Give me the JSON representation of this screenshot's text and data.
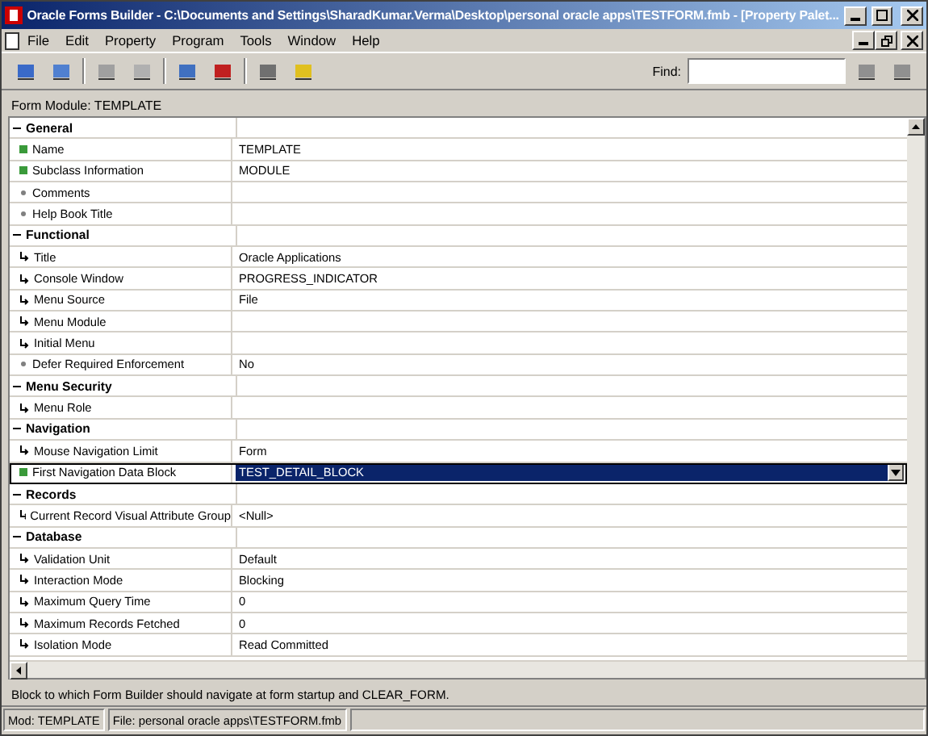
{
  "window": {
    "title": "Oracle Forms Builder - C:\\Documents and Settings\\SharadKumar.Verma\\Desktop\\personal oracle apps\\TESTFORM.fmb - [Property Palet..."
  },
  "menu": [
    {
      "label": "File"
    },
    {
      "label": "Edit"
    },
    {
      "label": "Property"
    },
    {
      "label": "Program"
    },
    {
      "label": "Tools"
    },
    {
      "label": "Window"
    },
    {
      "label": "Help"
    }
  ],
  "find": {
    "label": "Find:"
  },
  "context": "Form Module: TEMPLATE",
  "groups": [
    {
      "label": "General",
      "expanded": true,
      "properties": [
        {
          "name": "Name",
          "kind": "set",
          "value": "TEMPLATE",
          "selected": false
        },
        {
          "name": "Subclass Information",
          "kind": "set",
          "value": "MODULE",
          "selected": false
        },
        {
          "name": "Comments",
          "kind": "default",
          "selected": false
        },
        {
          "name": "Help Book Title",
          "kind": "default",
          "selected": false
        }
      ]
    },
    {
      "label": "Functional",
      "expanded": true,
      "properties": [
        {
          "name": "Title",
          "kind": "inherited",
          "value": "Oracle Applications",
          "selected": false
        },
        {
          "name": "Console Window",
          "kind": "inherited",
          "value": "PROGRESS_INDICATOR",
          "selected": false
        },
        {
          "name": "Menu Source",
          "kind": "inherited",
          "value": "File",
          "selected": false
        },
        {
          "name": "Menu Module",
          "kind": "inherited",
          "selected": false
        },
        {
          "name": "Initial Menu",
          "kind": "inherited",
          "selected": false
        },
        {
          "name": "Defer Required Enforcement",
          "kind": "default",
          "value": "No",
          "selected": false
        }
      ]
    },
    {
      "label": "Menu Security",
      "expanded": true,
      "properties": [
        {
          "name": "Menu Role",
          "kind": "inherited",
          "selected": false
        }
      ]
    },
    {
      "label": "Navigation",
      "expanded": true,
      "properties": [
        {
          "name": "Mouse Navigation Limit",
          "kind": "inherited",
          "value": "Form",
          "selected": false
        },
        {
          "name": "First Navigation Data Block",
          "kind": "set",
          "value": "TEST_DETAIL_BLOCK",
          "selected": true
        }
      ]
    },
    {
      "label": "Records",
      "expanded": true,
      "properties": [
        {
          "name": "Current Record Visual Attribute Group",
          "kind": "inherited",
          "value": "<Null>",
          "selected": false
        }
      ]
    },
    {
      "label": "Database",
      "expanded": true,
      "properties": [
        {
          "name": "Validation Unit",
          "kind": "inherited",
          "value": "Default",
          "selected": false
        },
        {
          "name": "Interaction Mode",
          "kind": "inherited",
          "value": "Blocking",
          "selected": false
        },
        {
          "name": "Maximum Query Time",
          "kind": "inherited",
          "value": "0",
          "selected": false
        },
        {
          "name": "Maximum Records Fetched",
          "kind": "inherited",
          "value": "0",
          "selected": false
        },
        {
          "name": "Isolation Mode",
          "kind": "inherited",
          "value": "Read Committed",
          "selected": false
        }
      ]
    }
  ],
  "description": "Block to which Form Builder should navigate at form startup and CLEAR_FORM.",
  "status_bar": [
    "Mod: TEMPLATE",
    "File: personal oracle apps\\TESTFORM.fmb"
  ]
}
